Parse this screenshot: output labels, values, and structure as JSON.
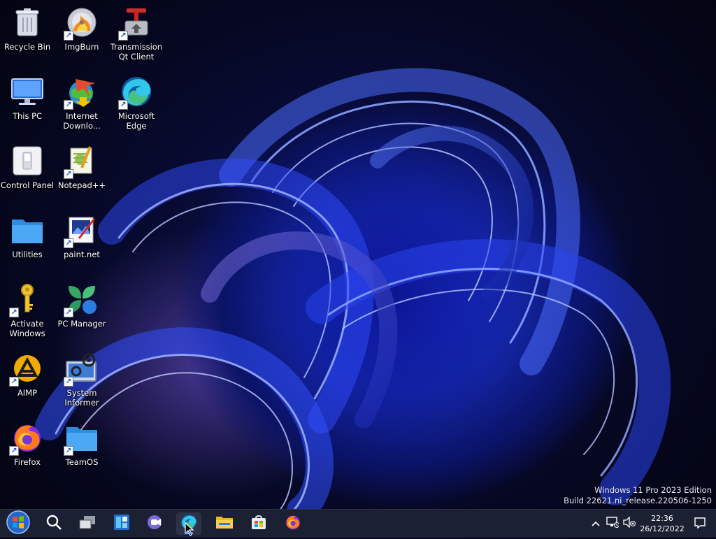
{
  "desktop": {
    "icons": [
      {
        "name": "recycle-bin",
        "label": "Recycle Bin",
        "shortcut": false
      },
      {
        "name": "imgburn",
        "label": "ImgBurn",
        "shortcut": true
      },
      {
        "name": "transmission",
        "label": "Transmission Qt Client",
        "shortcut": true
      },
      {
        "name": "this-pc",
        "label": "This PC",
        "shortcut": false
      },
      {
        "name": "internet-download-manager",
        "label": "Internet Downlo...",
        "shortcut": true
      },
      {
        "name": "microsoft-edge",
        "label": "Microsoft Edge",
        "shortcut": true
      },
      {
        "name": "control-panel",
        "label": "Control Panel",
        "shortcut": false
      },
      {
        "name": "notepad-plus-plus",
        "label": "Notepad++",
        "shortcut": true
      },
      {
        "name": "utilities",
        "label": "Utilities",
        "shortcut": false
      },
      {
        "name": "paint-net",
        "label": "paint.net",
        "shortcut": true
      },
      {
        "name": "activate-windows",
        "label": "Activate Windows",
        "shortcut": true
      },
      {
        "name": "pc-manager",
        "label": "PC Manager",
        "shortcut": true
      },
      {
        "name": "aimp",
        "label": "AIMP",
        "shortcut": true
      },
      {
        "name": "system-informer",
        "label": "System Informer",
        "shortcut": true
      },
      {
        "name": "firefox",
        "label": "Firefox",
        "shortcut": true
      },
      {
        "name": "teamos",
        "label": "TeamOS",
        "shortcut": true
      }
    ]
  },
  "watermark": {
    "line1": "Windows 11 Pro 2023 Edition",
    "line2": "Build 22621.ni_release.220506-1250"
  },
  "taskbar": {
    "items": [
      "start-icon",
      "search-icon",
      "task-view-icon",
      "widgets-icon",
      "teams-chat-icon",
      "edge-icon",
      "file-explorer-icon",
      "store-icon",
      "firefox-icon"
    ],
    "active": "edge-icon",
    "tray": {
      "time": "22:36",
      "date": "26/12/2022"
    }
  },
  "colors": {
    "taskbar": "#1c2033",
    "accent": "#1a5fd0",
    "wallpaper_deep": "#0a1366"
  }
}
